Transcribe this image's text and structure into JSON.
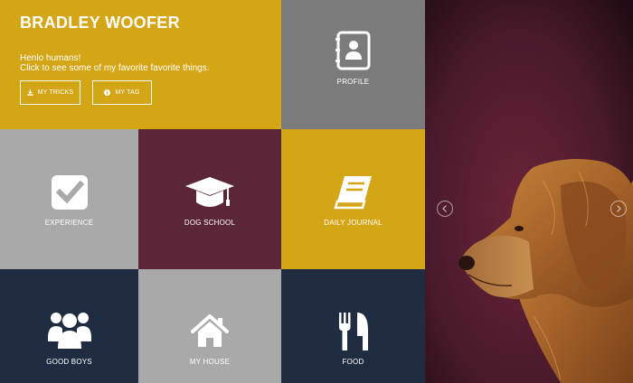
{
  "colors": {
    "gold": "#d4a514",
    "gray_dark": "#7b7b7b",
    "gray_light": "#a9a9a9",
    "maroon": "#5a2638",
    "navy": "#1f2c42"
  },
  "intro": {
    "title": "BRADLEY WOOFER",
    "line1": "Henlo humans!",
    "line2": "Click to see some of my favorite favorite things.",
    "btn_tricks": "MY TRICKS",
    "btn_tag": "MY TAG"
  },
  "tiles": {
    "profile": "PROFILE",
    "experience": "EXPERIENCE",
    "school": "DOG SCHOOL",
    "journal": "DAILY JOURNAL",
    "goodboys": "GOOD BOYS",
    "house": "MY HOUSE",
    "food": "FOOD"
  }
}
